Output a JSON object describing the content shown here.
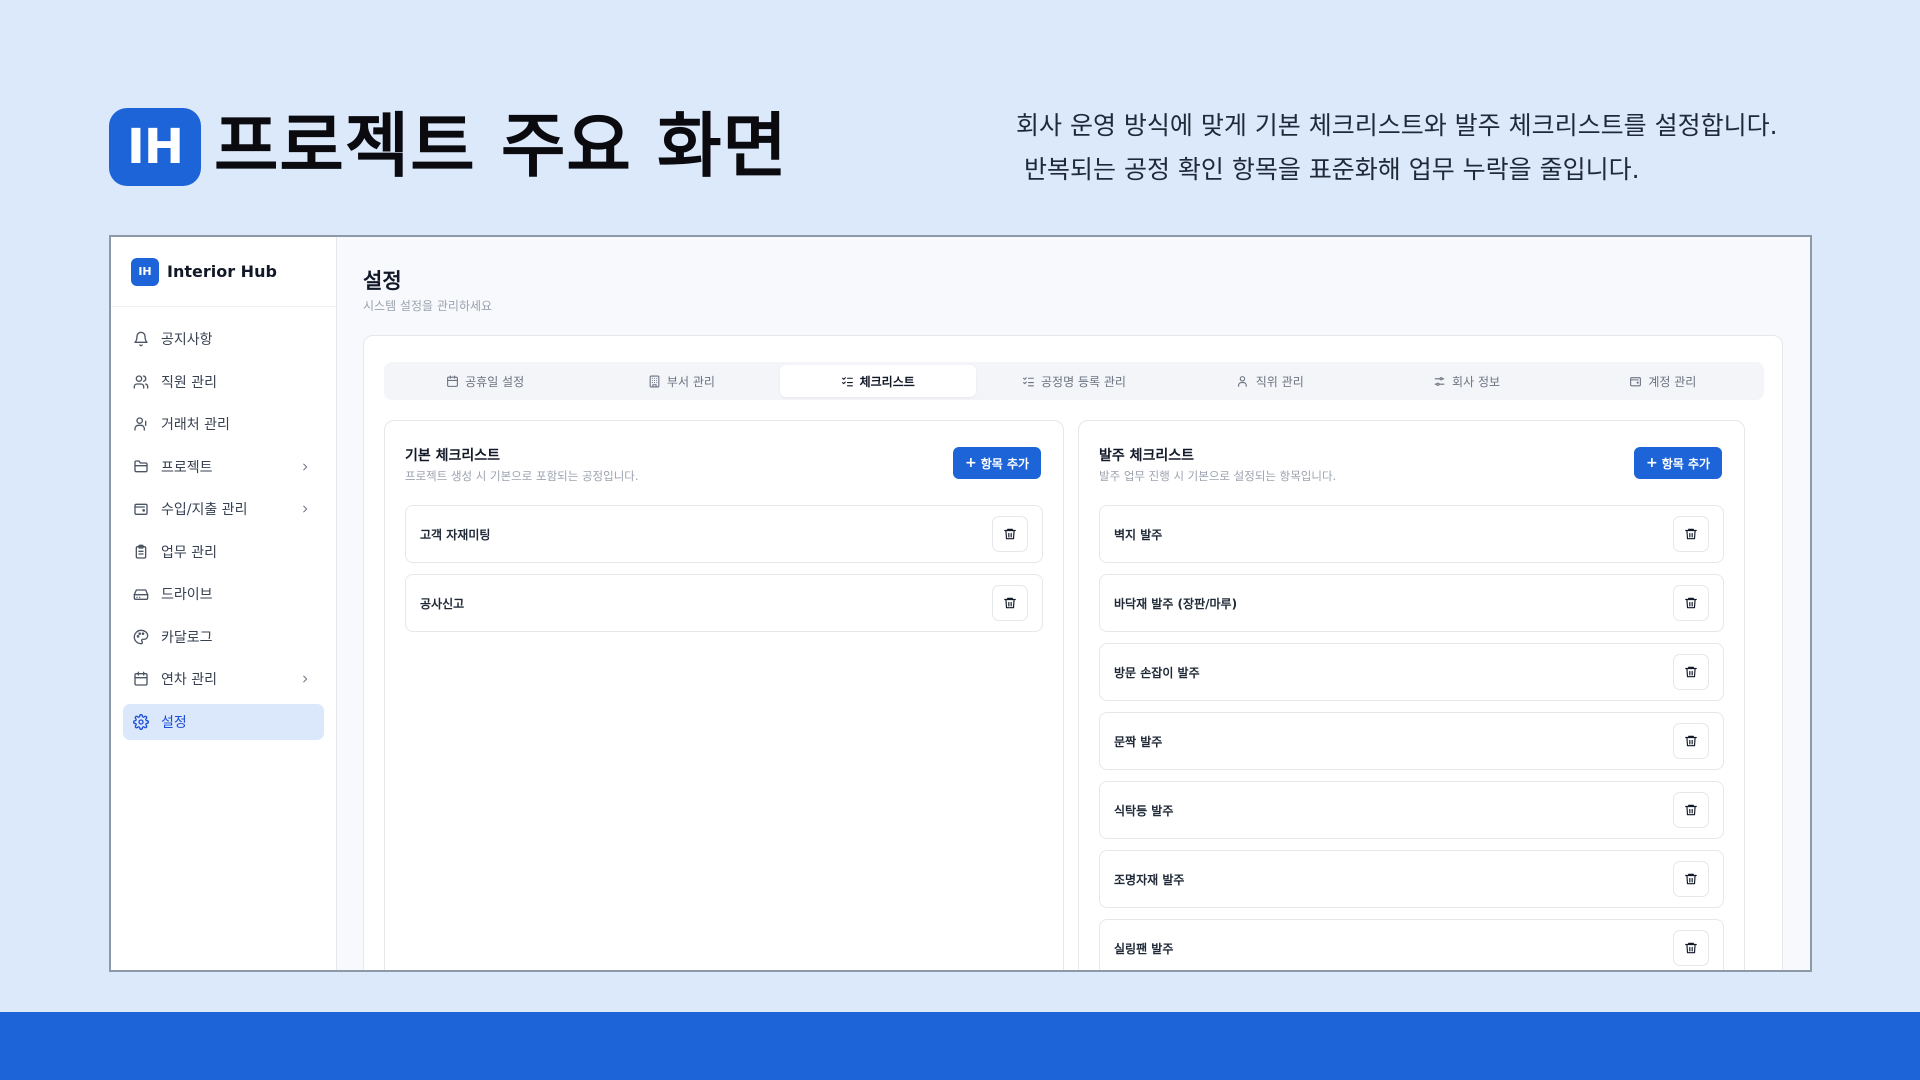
{
  "hero": {
    "logo": "IH",
    "title": "프로젝트 주요 화면",
    "desc_line1": "회사 운영 방식에 맞게 기본 체크리스트와 발주 체크리스트를 설정합니다.",
    "desc_line2": "반복되는 공정 확인 항목을 표준화해 업무 누락을 줄입니다."
  },
  "brand": {
    "logo": "IH",
    "name": "Interior Hub"
  },
  "sidebar": {
    "items": [
      {
        "label": "공지사항",
        "icon": "bell-icon"
      },
      {
        "label": "직원 관리",
        "icon": "users-icon"
      },
      {
        "label": "거래처 관리",
        "icon": "contacts-icon"
      },
      {
        "label": "프로젝트",
        "icon": "folder-icon",
        "expandable": true
      },
      {
        "label": "수입/지출 관리",
        "icon": "wallet-icon",
        "expandable": true
      },
      {
        "label": "업무 관리",
        "icon": "clipboard-icon"
      },
      {
        "label": "드라이브",
        "icon": "drive-icon"
      },
      {
        "label": "카달로그",
        "icon": "palette-icon"
      },
      {
        "label": "연차 관리",
        "icon": "calendar-icon",
        "expandable": true
      },
      {
        "label": "설정",
        "icon": "gear-icon",
        "active": true
      }
    ]
  },
  "page": {
    "title": "설정",
    "subtitle": "시스템 설정을 관리하세요"
  },
  "tabs": [
    {
      "label": "공휴일 설정",
      "icon": "calendar-icon"
    },
    {
      "label": "부서 관리",
      "icon": "building-icon"
    },
    {
      "label": "체크리스트",
      "icon": "checklist-icon",
      "active": true
    },
    {
      "label": "공정명 등록 관리",
      "icon": "checklist-icon"
    },
    {
      "label": "직위 관리",
      "icon": "user-icon"
    },
    {
      "label": "회사 정보",
      "icon": "sliders-icon"
    },
    {
      "label": "계정 관리",
      "icon": "wallet-icon"
    }
  ],
  "basic_checklist": {
    "title": "기본 체크리스트",
    "desc": "프로젝트 생성 시 기본으로 포함되는 공정입니다.",
    "add_label": "항목 추가",
    "items": [
      "고객 자재미팅",
      "공사신고"
    ]
  },
  "order_checklist": {
    "title": "발주 체크리스트",
    "desc": "발주 업무 진행 시 기본으로 설정되는 항목입니다.",
    "add_label": "항목 추가",
    "items": [
      "벽지 발주",
      "바닥재 발주 (장판/마루)",
      "방문 손잡이 발주",
      "문짝 발주",
      "식탁등 발주",
      "조명자재 발주",
      "실링팬 발주"
    ]
  },
  "colors": {
    "accent": "#1d64d8",
    "background": "#dbe9fb",
    "active_nav": "#dbe8fb"
  }
}
